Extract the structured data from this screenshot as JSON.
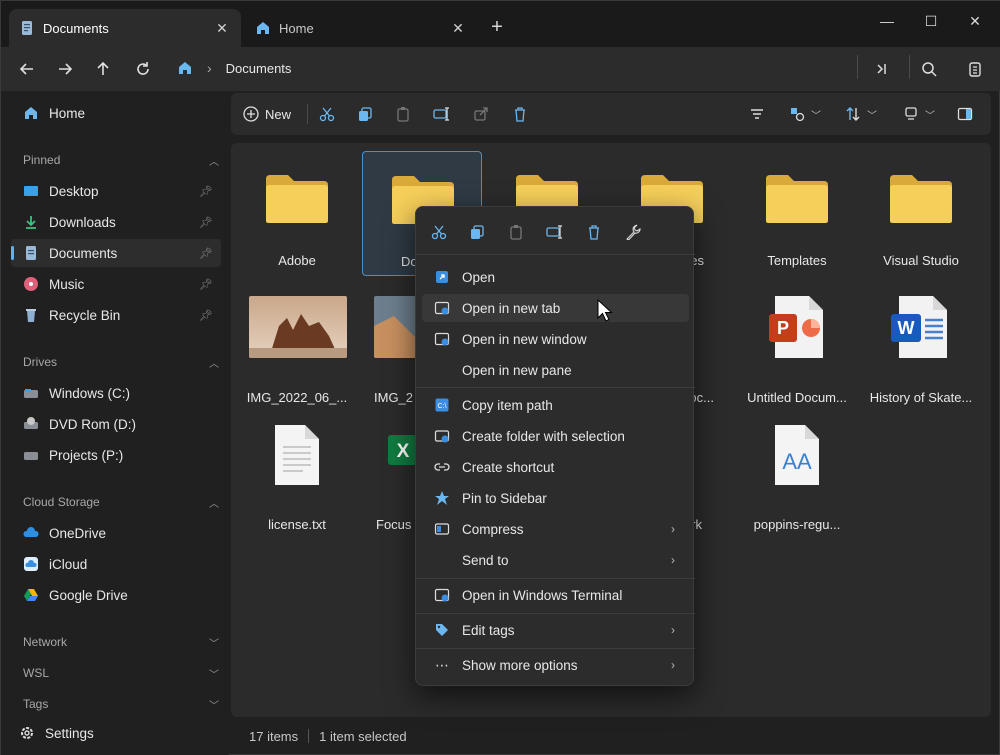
{
  "tabs": [
    {
      "label": "Documents",
      "icon": "document-icon"
    },
    {
      "label": "Home",
      "icon": "home-icon"
    }
  ],
  "address": {
    "crumbs": [
      "Documents"
    ]
  },
  "sidebar": {
    "home": "Home",
    "sections": {
      "pinned": "Pinned",
      "drives": "Drives",
      "cloud": "Cloud Storage",
      "network": "Network",
      "wsl": "WSL",
      "tags": "Tags"
    },
    "pinned": [
      "Desktop",
      "Downloads",
      "Documents",
      "Music",
      "Recycle Bin"
    ],
    "drives": [
      "Windows (C:)",
      "DVD Rom (D:)",
      "Projects (P:)"
    ],
    "cloud": [
      "OneDrive",
      "iCloud",
      "Google Drive"
    ],
    "settings": "Settings"
  },
  "toolbar": {
    "new_label": "New"
  },
  "files": [
    {
      "label": "Adobe"
    },
    {
      "label": "Do"
    },
    {
      "label": "es"
    },
    {
      "label": "Templates"
    },
    {
      "label": "Visual Studio"
    },
    {
      "label": "IMG_2022_06_..."
    },
    {
      "label": "IMG_2"
    },
    {
      "label": "oc..."
    },
    {
      "label": "Untitled Docum..."
    },
    {
      "label": "History of Skate..."
    },
    {
      "label": "license.txt"
    },
    {
      "label": "Focus"
    },
    {
      "label": "rk"
    },
    {
      "label": "poppins-regu..."
    }
  ],
  "status": {
    "items": "17 items",
    "selected": "1 item selected"
  },
  "context_menu": {
    "items": [
      "Open",
      "Open in new tab",
      "Open in new window",
      "Open in new pane",
      "Copy item path",
      "Create folder with selection",
      "Create shortcut",
      "Pin to Sidebar",
      "Compress",
      "Send to",
      "Open in Windows Terminal",
      "Edit tags",
      "Show more options"
    ]
  },
  "colors": {
    "accent": "#5fb2f2",
    "folder": "#f3c64a",
    "bg": "#202020"
  }
}
